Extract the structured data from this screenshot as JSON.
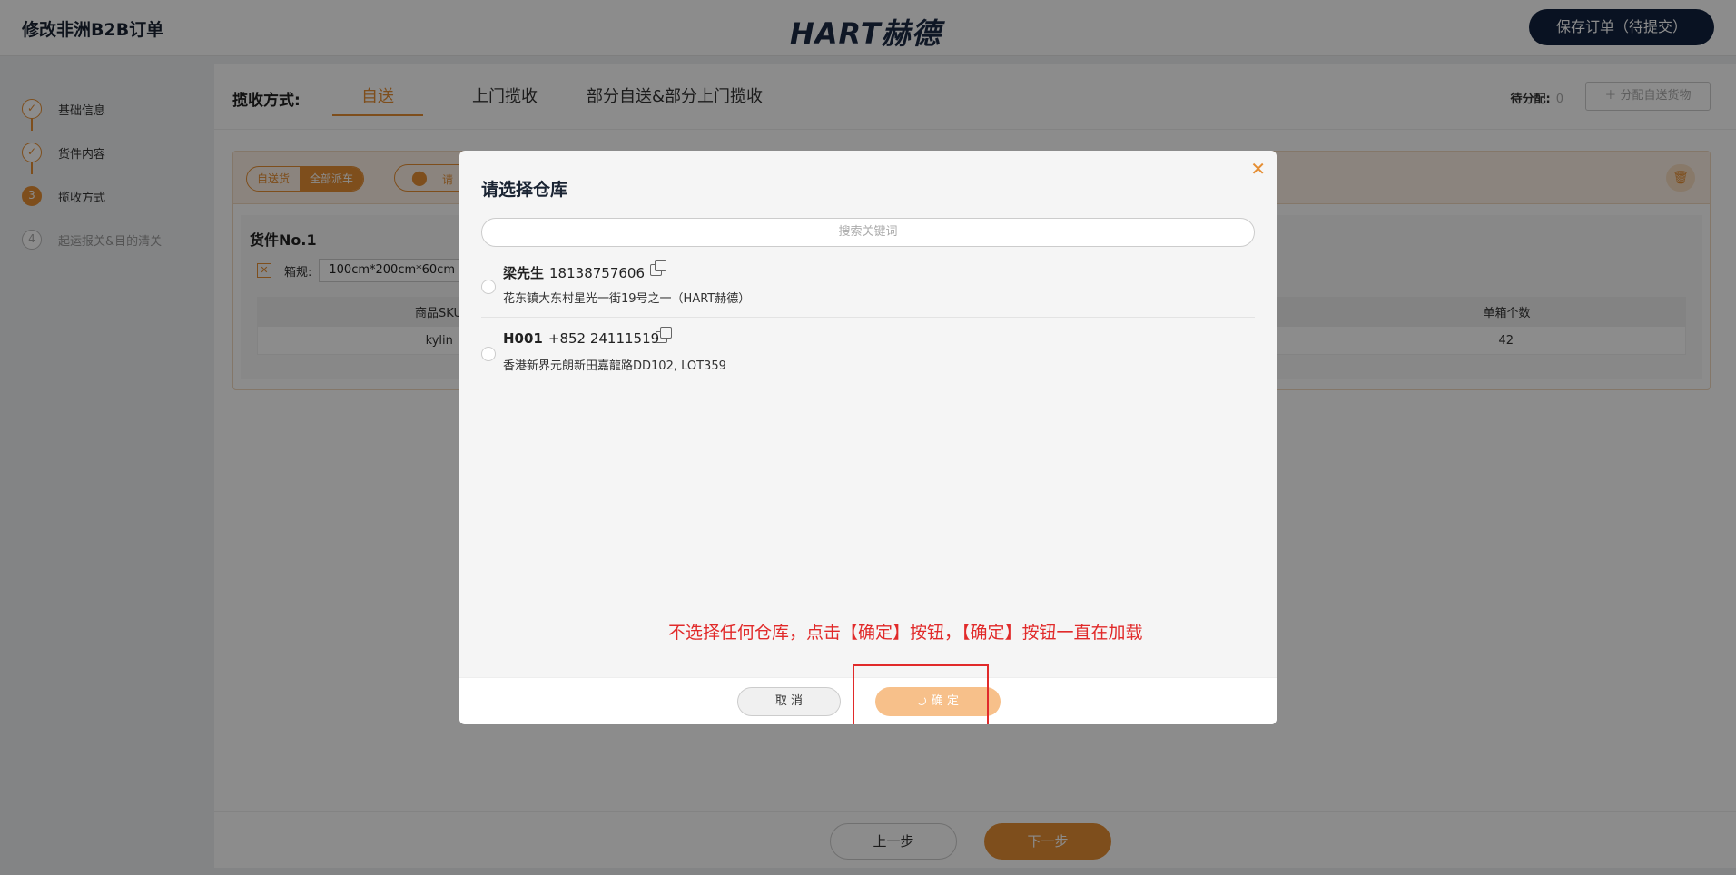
{
  "header": {
    "title": "修改非洲B2B订单",
    "logo_latin": "HART",
    "logo_cjk": "赫德",
    "save_label": "保存订单（待提交）"
  },
  "steps": [
    {
      "num": "✓",
      "label": "基础信息",
      "state": "done"
    },
    {
      "num": "✓",
      "label": "货件内容",
      "state": "done"
    },
    {
      "num": "3",
      "label": "揽收方式",
      "state": "active"
    },
    {
      "num": "4",
      "label": "起运报关&目的清关",
      "state": "todo"
    }
  ],
  "main": {
    "method_label": "揽收方式:",
    "tabs": [
      "自送",
      "上门揽收",
      "部分自送&部分上门揽收"
    ],
    "active_tab": 0,
    "pending_label": "待分配:",
    "pending_value": "0",
    "assign_label": "＋ 分配自送货物",
    "toggle_left": "自送货",
    "toggle_right": "全部派车",
    "loc_text": "请",
    "goods_title": "货件No.1",
    "box_label": "箱规:",
    "box_value": "100cm*200cm*60cm",
    "table_headers": [
      "商品SKU",
      "",
      "单箱个数"
    ],
    "table_row": [
      "kylin",
      "",
      "42"
    ],
    "prev_label": "上一步",
    "next_label": "下一步"
  },
  "modal": {
    "title": "请选择仓库",
    "close_icon": "close-icon",
    "search_placeholder": "搜索关键词",
    "warehouses": [
      {
        "name": "梁先生",
        "phone": "18138757606",
        "address": "花东镇大东村星光一街19号之一（HART赫德）"
      },
      {
        "name": "H001",
        "phone": "+852 24111519",
        "address": "香港新界元朗新田嘉龍路DD102, LOT359"
      }
    ],
    "annotation": "不选择任何仓库，点击【确定】按钮，【确定】按钮一直在加载",
    "cancel_label": "取 消",
    "confirm_label": "确 定"
  },
  "colors": {
    "accent": "#e58e33",
    "navy": "#12223f",
    "annotation_red": "#e12a2a"
  }
}
